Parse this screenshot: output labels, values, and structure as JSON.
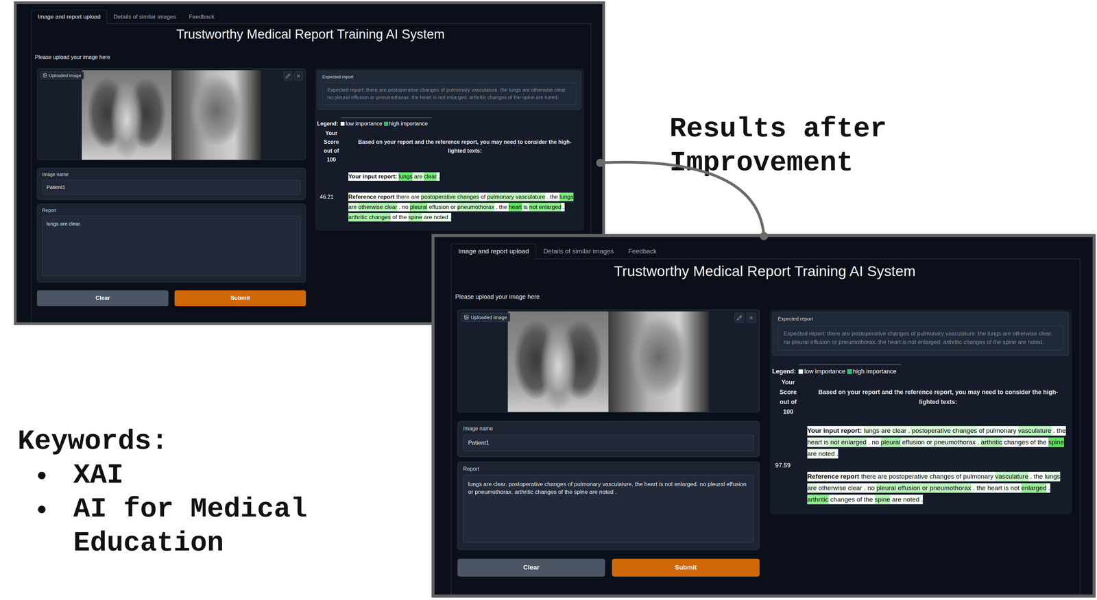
{
  "heading": "Results after Improvement",
  "keywords": {
    "title": "Keywords:",
    "items": [
      "XAI",
      "AI for Medical Education"
    ]
  },
  "windows": [
    {
      "tabs": [
        {
          "label": "Image and report upload",
          "selected": true
        },
        {
          "label": "Details of similar images",
          "selected": false
        },
        {
          "label": "Feedback",
          "selected": false
        }
      ],
      "title": "Trustworthy Medical Report Training AI System",
      "prompt": "Please upload your image here",
      "image": {
        "label": "Uploaded image"
      },
      "image_name": {
        "label": "Image name",
        "value": "Patient1"
      },
      "report": {
        "label": "Report",
        "value": "lungs are clear."
      },
      "buttons": [
        {
          "label": "Clear",
          "kind": "secondary"
        },
        {
          "label": "Submit",
          "kind": "primary"
        }
      ],
      "expected": {
        "label": "Expected report",
        "value": "Expected report: there are postoperative changes of pulmonary vasculature. the lungs are otherwise clear. no pleural effusion or pneumothorax. the heart is not enlarged. arthritic changes of the spine are noted."
      },
      "legend": {
        "title": "Legend:",
        "items": [
          {
            "label": "low importance",
            "color": "#ffffff"
          },
          {
            "label": "high importance",
            "color": "#22c55e"
          }
        ]
      },
      "score_header": "Your Score out of 100",
      "advice": "Based on your report and the reference report, you may need to consider the high-lighted texts:",
      "score": "46.21",
      "input": {
        "label": "Your input report:",
        "tokens": [
          {
            "text": "lungs",
            "level": 0.7
          },
          {
            "text": " are ",
            "level": 0.2
          },
          {
            "text": "clear",
            "level": 0.6
          },
          {
            "text": " .",
            "level": 0.1
          }
        ]
      },
      "reference": {
        "label": "Reference report",
        "tokens": [
          {
            "text": "there are ",
            "level": 0
          },
          {
            "text": "postoperative changes",
            "level": 0.3
          },
          {
            "text": " of ",
            "level": 0
          },
          {
            "text": "pulmonary vasculature",
            "level": 0.3
          },
          {
            "text": " . the ",
            "level": 0
          },
          {
            "text": "lungs",
            "level": 0.6
          },
          {
            "text": " are ",
            "level": 0.15
          },
          {
            "text": "otherwise clear",
            "level": 0.35
          },
          {
            "text": " . no ",
            "level": 0
          },
          {
            "text": "pleural",
            "level": 0.5
          },
          {
            "text": " effusion or ",
            "level": 0.1
          },
          {
            "text": "pneumothorax",
            "level": 0.3
          },
          {
            "text": " . the ",
            "level": 0
          },
          {
            "text": "heart",
            "level": 0.75
          },
          {
            "text": " is ",
            "level": 0.2
          },
          {
            "text": "not enlarged",
            "level": 0.55
          },
          {
            "text": " . ",
            "level": 0
          },
          {
            "text": "arthritic changes",
            "level": 0.4
          },
          {
            "text": " of the ",
            "level": 0
          },
          {
            "text": "spine",
            "level": 0.35
          },
          {
            "text": " are noted .",
            "level": 0.1
          }
        ]
      }
    },
    {
      "tabs": [
        {
          "label": "Image and report upload",
          "selected": true
        },
        {
          "label": "Details of similar images",
          "selected": false
        },
        {
          "label": "Feedback",
          "selected": false
        }
      ],
      "title": "Trustworthy Medical Report Training AI System",
      "prompt": "Please upload your image here",
      "image": {
        "label": "Uploaded image"
      },
      "image_name": {
        "label": "Image name",
        "value": "Patient1"
      },
      "report": {
        "label": "Report",
        "value": "lungs are clear. postoperative changes of pulmonary vasculature. the heart is not enlarged. no pleural effusion or pneumothorax. arthritic changes of the spine are noted ."
      },
      "buttons": [
        {
          "label": "Clear",
          "kind": "secondary"
        },
        {
          "label": "Submit",
          "kind": "primary"
        }
      ],
      "expected": {
        "label": "Expected report",
        "value": "Expected report: there are postoperative changes of pulmonary vasculature. the lungs are otherwise clear. no pleural effusion or pneumothorax. the heart is not enlarged. arthritic changes of the spine are noted."
      },
      "legend": {
        "title": "Legend:",
        "items": [
          {
            "label": "low importance",
            "color": "#ffffff"
          },
          {
            "label": "high importance",
            "color": "#22c55e"
          }
        ]
      },
      "score_header": "Your Score out of 100",
      "advice": "Based on your report and the reference report, you may need to consider the high-lighted texts:",
      "score": "97.59",
      "input": {
        "label": "Your input report:",
        "tokens": [
          {
            "text": "lungs are clear .",
            "level": 0.12
          },
          {
            "text": " postoperative changes",
            "level": 0.18
          },
          {
            "text": " of pulmonary ",
            "level": 0.06
          },
          {
            "text": "vasculature",
            "level": 0.3
          },
          {
            "text": " . the ",
            "level": 0
          },
          {
            "text": "heart is",
            "level": 0.1
          },
          {
            "text": " not enlarged",
            "level": 0.25
          },
          {
            "text": " . no ",
            "level": 0
          },
          {
            "text": "pleural",
            "level": 0.4
          },
          {
            "text": " effusion or pneumothorax . ",
            "level": 0.12
          },
          {
            "text": "arthritic",
            "level": 0.3
          },
          {
            "text": " changes of the ",
            "level": 0
          },
          {
            "text": "spine",
            "level": 0.75
          },
          {
            "text": " are noted .",
            "level": 0.08
          }
        ]
      },
      "reference": {
        "label": "Reference report",
        "tokens": [
          {
            "text": "there are postoperative changes of pulmonary ",
            "level": 0.05
          },
          {
            "text": "vasculature",
            "level": 0.3
          },
          {
            "text": " . the ",
            "level": 0
          },
          {
            "text": "lungs are",
            "level": 0.15
          },
          {
            "text": " otherwise clear . no ",
            "level": 0.04
          },
          {
            "text": "pleural effusion or pneumothorax",
            "level": 0.3
          },
          {
            "text": " . the heart is not ",
            "level": 0.05
          },
          {
            "text": "enlarged",
            "level": 0.45
          },
          {
            "text": " . ",
            "level": 0
          },
          {
            "text": "arthritic",
            "level": 0.55
          },
          {
            "text": " changes of the ",
            "level": 0
          },
          {
            "text": "spine",
            "level": 0.35
          },
          {
            "text": " are noted .",
            "level": 0.05
          }
        ]
      }
    }
  ]
}
